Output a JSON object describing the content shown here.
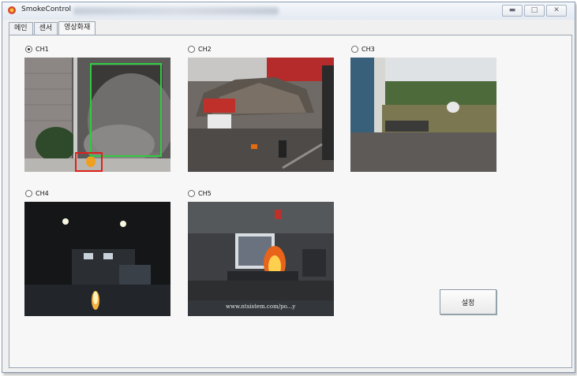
{
  "window": {
    "title": "SmokeControl"
  },
  "tabs": [
    {
      "label": "메인",
      "active": false
    },
    {
      "label": "센서",
      "active": false
    },
    {
      "label": "영상화재",
      "active": true
    }
  ],
  "channels": [
    {
      "label": "CH1",
      "selected": true
    },
    {
      "label": "CH2",
      "selected": false
    },
    {
      "label": "CH3",
      "selected": false
    },
    {
      "label": "CH4",
      "selected": false
    },
    {
      "label": "CH5",
      "selected": false
    }
  ],
  "ch5_watermark": "www.ntsistem.com/po...y",
  "buttons": {
    "settings_label": "설정"
  }
}
